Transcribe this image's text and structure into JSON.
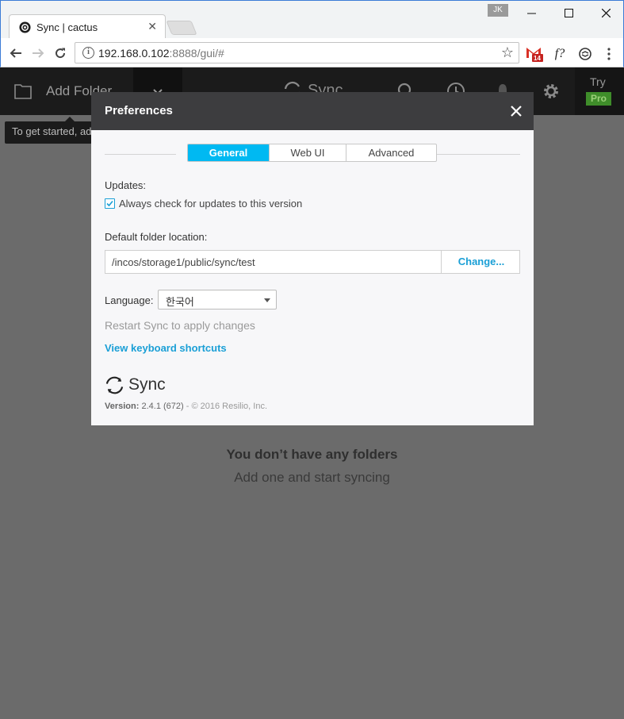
{
  "browser": {
    "tab_title": "Sync | cactus",
    "profile_badge": "JK",
    "url_host": "192.168.0.102",
    "url_rest": ":8888/gui/#",
    "gmail_count": "14"
  },
  "app": {
    "add_folder_label": "Add Folder",
    "logo_text": "Sync",
    "try_label": "Try",
    "pro_label": "Pro",
    "tooltip_text": "To get started, ad",
    "empty_title": "You don’t have any folders",
    "empty_subtitle": "Add one and start syncing"
  },
  "preferences": {
    "title": "Preferences",
    "tabs": [
      {
        "label": "General",
        "active": true
      },
      {
        "label": "Web UI",
        "active": false
      },
      {
        "label": "Advanced",
        "active": false
      }
    ],
    "updates_label": "Updates:",
    "auto_update_checked": true,
    "auto_update_text": "Always check for updates to this version",
    "folder_location_label": "Default folder location:",
    "folder_location_value": "/incos/storage1/public/sync/test",
    "change_label": "Change...",
    "language_label": "Language:",
    "language_value": "한국어",
    "restart_note": "Restart Sync to apply changes",
    "shortcuts_link": "View keyboard shortcuts",
    "brand_text": "Sync",
    "version_label": "Version:",
    "version_value": "2.4.1 (672)",
    "copyright": "- © 2016 Resilio, Inc."
  },
  "colors": {
    "accent": "#00b9f2",
    "link": "#1a9fd6",
    "modal_header": "#3d3d3f",
    "pro_badge": "#3f8d2a"
  }
}
